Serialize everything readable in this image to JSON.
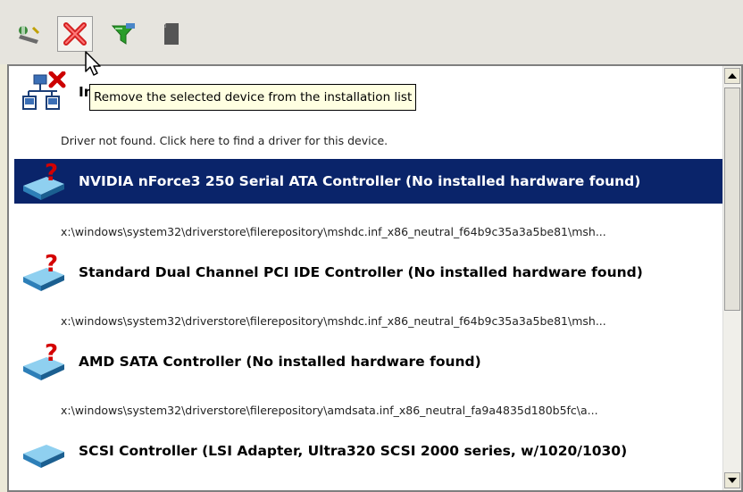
{
  "toolbar": {
    "buttons": [
      {
        "name": "add-driver",
        "icon": "add-driver-icon"
      },
      {
        "name": "remove-device",
        "icon": "red-x-icon",
        "pressed": true
      },
      {
        "name": "filter",
        "icon": "filter-icon"
      },
      {
        "name": "device",
        "icon": "chip-icon"
      }
    ]
  },
  "tooltip": {
    "text": "Remove the selected device from the installation list"
  },
  "devices": [
    {
      "title": "In",
      "subtitle": "Driver not found. Click here to find a driver for this device.",
      "selected": false
    },
    {
      "title": "NVIDIA nForce3 250 Serial ATA Controller (No installed hardware found)",
      "subtitle": "x:\\windows\\system32\\driverstore\\filerepository\\mshdc.inf_x86_neutral_f64b9c35a3a5be81\\msh...",
      "selected": true
    },
    {
      "title": "Standard Dual Channel PCI IDE Controller (No installed hardware found)",
      "subtitle": "x:\\windows\\system32\\driverstore\\filerepository\\mshdc.inf_x86_neutral_f64b9c35a3a5be81\\msh...",
      "selected": false
    },
    {
      "title": "AMD SATA Controller (No installed hardware found)",
      "subtitle": "x:\\windows\\system32\\driverstore\\filerepository\\amdsata.inf_x86_neutral_fa9a4835d180b5fc\\a...",
      "selected": false
    },
    {
      "title": "SCSI Controller (LSI Adapter, Ultra320 SCSI 2000 series, w/1020/1030)",
      "subtitle": "",
      "selected": false
    }
  ],
  "colors": {
    "selection": "#0a246a",
    "tooltip_bg": "#ffffe1",
    "warning_red": "#cc0000"
  }
}
